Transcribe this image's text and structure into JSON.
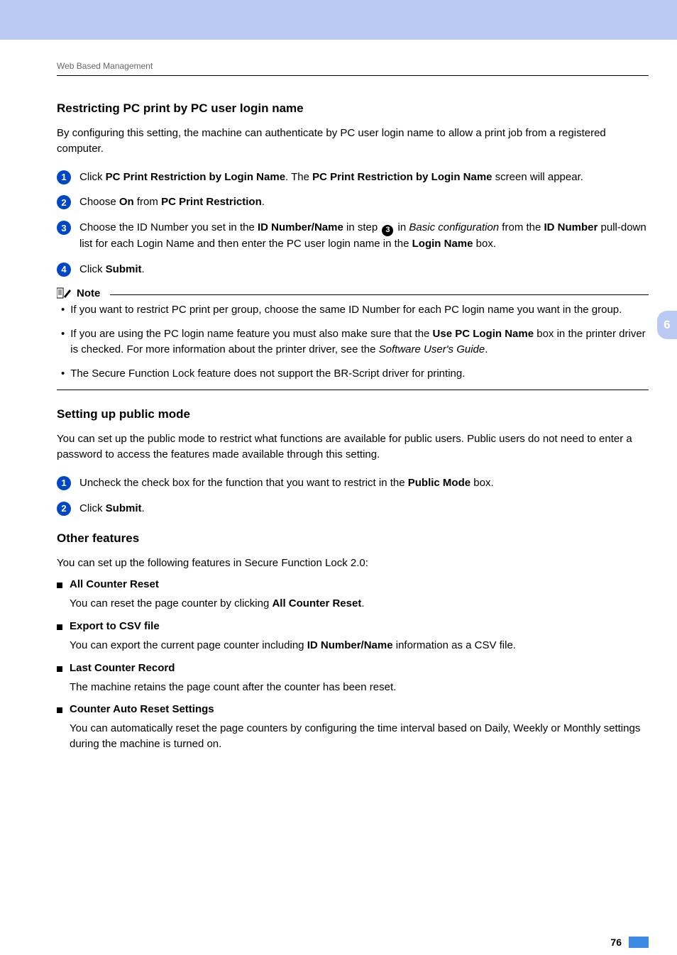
{
  "breadcrumb": "Web Based Management",
  "chapterTab": "6",
  "pageNumber": "76",
  "section1": {
    "title": "Restricting PC print by PC user login name",
    "intro": "By configuring this setting, the machine can authenticate by PC user login name to allow a print job from a registered computer.",
    "steps": {
      "s1_a": "Click ",
      "s1_b1": "PC Print Restriction by Login Name",
      "s1_c": ". The ",
      "s1_b2": "PC Print Restriction by Login Name",
      "s1_d": " screen will appear.",
      "s2_a": "Choose ",
      "s2_b1": "On",
      "s2_c": " from ",
      "s2_b2": "PC Print Restriction",
      "s2_d": ".",
      "s3_a": "Choose the ID Number you set in the ",
      "s3_b1": "ID Number/Name",
      "s3_c": " in step ",
      "s3_badge": "3",
      "s3_d": " in ",
      "s3_i1": "Basic configuration",
      "s3_e": " from the ",
      "s3_b2": "ID Number",
      "s3_f": " pull-down list for each Login Name and then enter the PC user login name in the ",
      "s3_b3": "Login Name",
      "s3_g": " box.",
      "s4_a": "Click ",
      "s4_b1": "Submit",
      "s4_c": "."
    }
  },
  "note": {
    "label": "Note",
    "n1": "If you want to restrict PC print per group, choose the same ID Number for each PC login name you want in the group.",
    "n2_a": "If you are using the PC login name feature you must also make sure that the ",
    "n2_b": "Use PC Login Name",
    "n2_c": " box in the printer driver is checked. For more information about the printer driver, see the ",
    "n2_i": "Software User's Guide",
    "n2_d": ".",
    "n3": "The Secure Function Lock feature does not support the BR-Script driver for printing."
  },
  "section2": {
    "title": "Setting up public mode",
    "intro": "You can set up the public mode to restrict what functions are available for public users. Public users do not need to enter a password to access the features made available through this setting.",
    "steps": {
      "s1_a": "Uncheck the check box for the function that you want to restrict in the ",
      "s1_b": "Public Mode",
      "s1_c": " box.",
      "s2_a": "Click ",
      "s2_b": "Submit",
      "s2_c": "."
    }
  },
  "section3": {
    "title": "Other features",
    "intro": "You can set up the following features in Secure Function Lock 2.0:",
    "features": {
      "f1_title": "All Counter Reset",
      "f1_a": "You can reset the page counter by clicking ",
      "f1_b": "All Counter Reset",
      "f1_c": ".",
      "f2_title": "Export to CSV file",
      "f2_a": "You can export the current page counter including ",
      "f2_b": "ID Number/Name",
      "f2_c": " information as a CSV file.",
      "f3_title": "Last Counter Record",
      "f3_desc": "The machine retains the page count after the counter has been reset.",
      "f4_title": "Counter Auto Reset Settings",
      "f4_desc": "You can automatically reset the page counters by configuring the time interval based on Daily, Weekly or Monthly settings during the machine is turned on."
    }
  }
}
